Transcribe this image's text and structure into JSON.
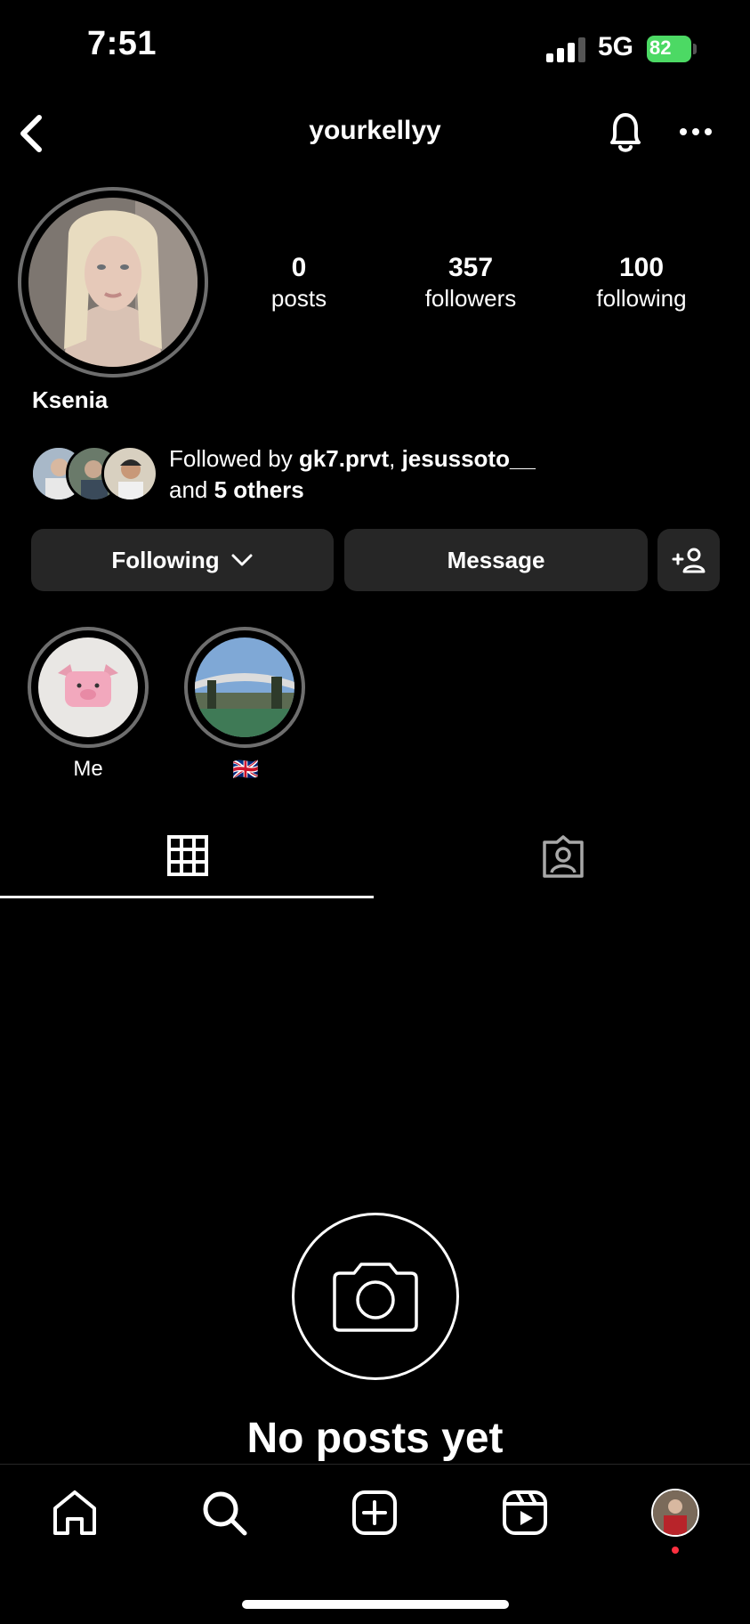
{
  "status_bar": {
    "time": "7:51",
    "network": "5G",
    "battery": "82"
  },
  "header": {
    "username": "yourkellyy"
  },
  "profile": {
    "display_name": "Ksenia",
    "stats": [
      {
        "value": "0",
        "label": "posts"
      },
      {
        "value": "357",
        "label": "followers"
      },
      {
        "value": "100",
        "label": "following"
      }
    ],
    "followed_by": {
      "prefix": "Followed by ",
      "user1": "gk7.prvt",
      "separator": ", ",
      "user2": "jesussoto__",
      "and": "and ",
      "others": "5 others"
    }
  },
  "actions": {
    "following": "Following",
    "message": "Message"
  },
  "highlights": [
    {
      "label": "Me"
    },
    {
      "label": "🇬🇧"
    }
  ],
  "empty_state": {
    "title": "No posts yet"
  },
  "nav": {
    "items": [
      "home-icon",
      "search-icon",
      "create-icon",
      "reels-icon",
      "profile-avatar"
    ]
  },
  "colors": {
    "background": "#000000",
    "button": "#262626",
    "ring": "#6e6e6e",
    "battery": "#4cd964",
    "notification_dot": "#ff3040"
  }
}
